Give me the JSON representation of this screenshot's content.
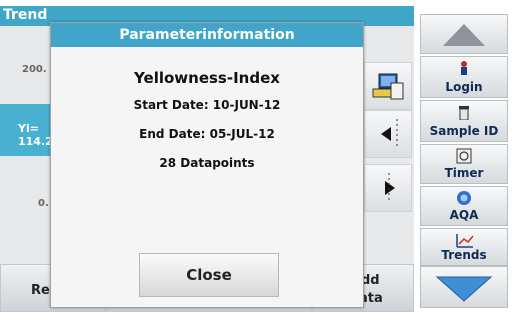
{
  "background": {
    "title": "Trend",
    "y_axis_top": "200.",
    "y_label_line1": "Yi=",
    "y_label_line2": "114.2",
    "y_axis_mid": "0.",
    "bottom_left_label": "Re",
    "bottom_right_label_line1": "dd",
    "bottom_right_label_line2": "ata"
  },
  "sidebar": {
    "items": [
      {
        "label": "Login",
        "icon": "person-icon"
      },
      {
        "label": "Sample ID",
        "icon": "vial-icon"
      },
      {
        "label": "Timer",
        "icon": "timer-icon"
      },
      {
        "label": "AQA",
        "icon": "aqa-icon"
      },
      {
        "label": "Trends",
        "icon": "trends-icon"
      }
    ]
  },
  "dialog": {
    "title": "Parameterinformation",
    "parameter": "Yellowness-Index",
    "start_date": "Start Date: 10-JUN-12",
    "end_date": "End Date: 05-JUL-12",
    "datapoints": "28 Datapoints",
    "close_label": "Close"
  },
  "colors": {
    "accent": "#40a5c9",
    "nav_text": "#0e2a55",
    "arrow": "#3f8fd3"
  }
}
